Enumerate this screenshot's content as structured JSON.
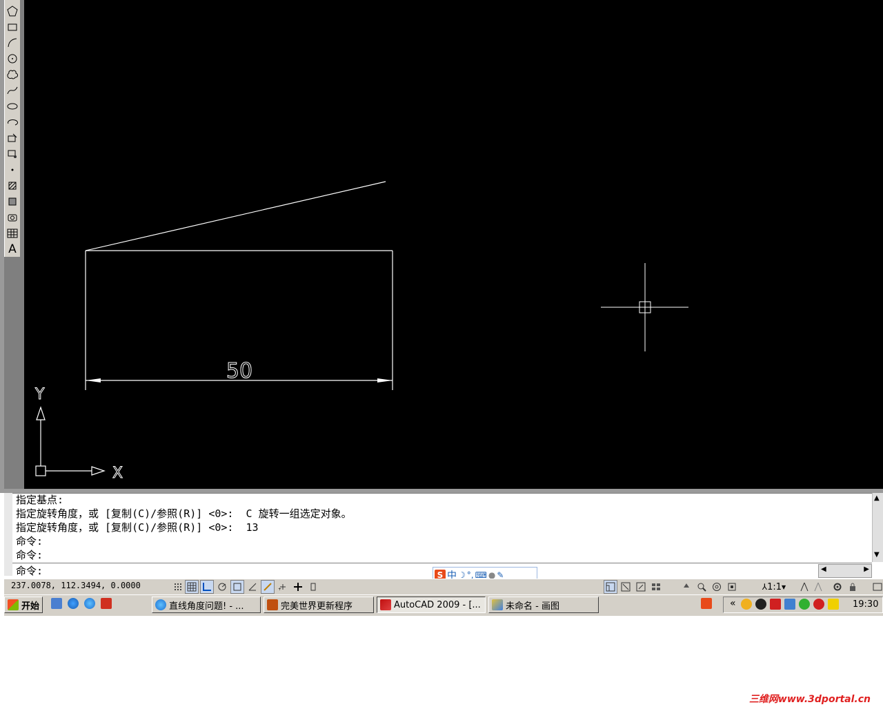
{
  "toolbar": {
    "tools": [
      "polygon",
      "rectangle",
      "arc",
      "circle",
      "revision-cloud",
      "spline",
      "ellipse",
      "ellipse-arc",
      "insert-block",
      "make-block",
      "point",
      "hatch",
      "gradient",
      "region",
      "table",
      "multiline-text"
    ],
    "text_tool_label": "A"
  },
  "drawing": {
    "dimension_text": "50",
    "ucs_x_label": "X",
    "ucs_y_label": "Y"
  },
  "command": {
    "lines": [
      "指定基点:",
      "指定旋转角度，或 [复制(C)/参照(R)] <0>:  C 旋转一组选定对象。",
      "指定旋转角度，或 [复制(C)/参照(R)] <0>:  13",
      "命令:",
      "命令:"
    ],
    "prompt": "命令:"
  },
  "status": {
    "coords": "237.0078, 112.3494, 0.0000",
    "annotation_scale": "1:1"
  },
  "ime": {
    "lang": "中"
  },
  "taskbar": {
    "start_label": "开始",
    "tasks": [
      {
        "label": "直线角度问题! - ..."
      },
      {
        "label": "完美世界更新程序"
      },
      {
        "label": "AutoCAD 2009 - [..."
      },
      {
        "label": "未命名 - 画图"
      }
    ],
    "tray_chevron": "«",
    "clock": "19:30"
  },
  "watermark": "三维网www.3dportal.cn"
}
